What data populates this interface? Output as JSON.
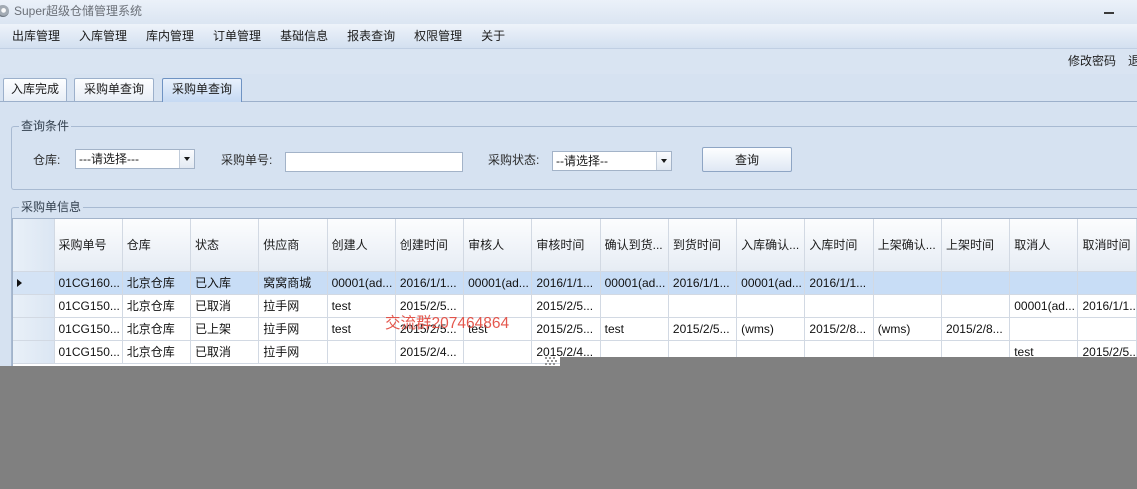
{
  "window": {
    "title": "Super超级仓储管理系统"
  },
  "menu": {
    "items": [
      {
        "label": "出库管理"
      },
      {
        "label": "入库管理"
      },
      {
        "label": "库内管理"
      },
      {
        "label": "订单管理"
      },
      {
        "label": "基础信息"
      },
      {
        "label": "报表查询"
      },
      {
        "label": "权限管理"
      },
      {
        "label": "关于"
      }
    ]
  },
  "account": {
    "change_password": "修改密码",
    "logout": "退"
  },
  "tabs": [
    {
      "label": "入库完成",
      "active": false
    },
    {
      "label": "采购单查询",
      "active": false
    },
    {
      "label": "采购单查询",
      "active": true
    }
  ],
  "query": {
    "legend": "查询条件",
    "warehouse": {
      "label": "仓库:",
      "value": "---请选择---"
    },
    "order_no": {
      "label": "采购单号:",
      "value": ""
    },
    "status": {
      "label": "采购状态:",
      "value": "--请选择--"
    },
    "search_button": "查询"
  },
  "grid": {
    "legend": "采购单信息",
    "columns": [
      "采购单号",
      "仓库",
      "状态",
      "供应商",
      "创建人",
      "创建时间",
      "审核人",
      "审核时间",
      "确认到货...",
      "到货时间",
      "入库确认...",
      "入库时间",
      "上架确认...",
      "上架时间",
      "取消人",
      "取消时间"
    ],
    "rows": [
      [
        "01CG160...",
        "北京仓库",
        "已入库",
        "窝窝商城",
        "00001(ad...",
        "2016/1/1...",
        "00001(ad...",
        "2016/1/1...",
        "00001(ad...",
        "2016/1/1...",
        "00001(ad...",
        "2016/1/1...",
        "",
        "",
        "",
        ""
      ],
      [
        "01CG150...",
        "北京仓库",
        "已取消",
        "拉手网",
        "test",
        "2015/2/5...",
        "",
        "2015/2/5...",
        "",
        "",
        "",
        "",
        "",
        "",
        "00001(ad...",
        "2016/1/1..."
      ],
      [
        "01CG150...",
        "北京仓库",
        "已上架",
        "拉手网",
        "test",
        "2015/2/5...",
        "test",
        "2015/2/5...",
        "test",
        "2015/2/5...",
        "(wms)",
        "2015/2/8...",
        "(wms)",
        "2015/2/8...",
        "",
        ""
      ],
      [
        "01CG150...",
        "北京仓库",
        "已取消",
        "拉手网",
        "",
        "2015/2/4...",
        "",
        "2015/2/4...",
        "",
        "",
        "",
        "",
        "",
        "",
        "test",
        "2015/2/5..."
      ]
    ],
    "selected_row": 0
  },
  "watermark": "交流群207464864",
  "icons": {
    "app": "app-logo-icon",
    "minimize": "minimize-icon",
    "dropdown": "chevron-down-icon",
    "current_row": "row-pointer-icon",
    "busy": "dots-icon"
  },
  "colors": {
    "background": "#d6e2f1",
    "selected_row": "#c8ddf6",
    "active_tab": "#c6daf3",
    "watermark": "#e2463b",
    "overlay": "#808080"
  }
}
